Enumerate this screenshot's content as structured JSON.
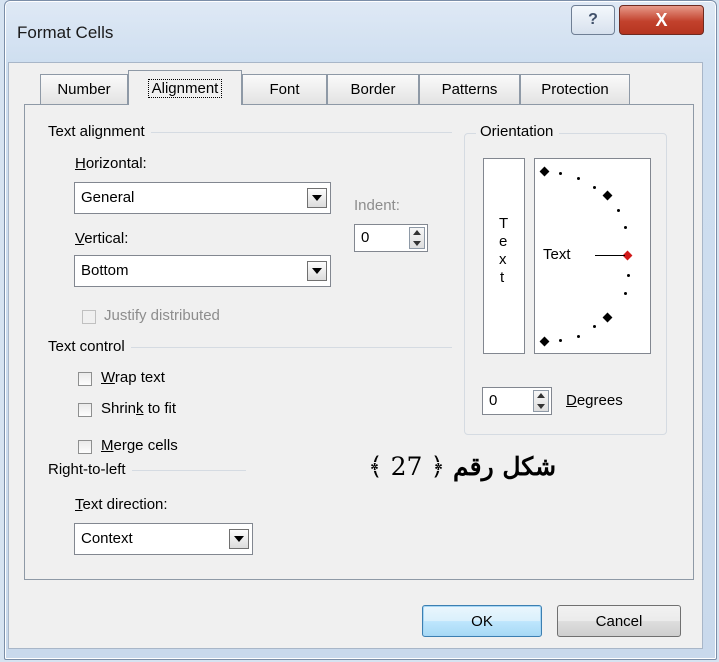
{
  "window": {
    "title": "Format Cells",
    "help_glyph": "?",
    "close_glyph": "X"
  },
  "tabs": [
    {
      "label": "Number"
    },
    {
      "label": "Alignment",
      "active": true
    },
    {
      "label": "Font"
    },
    {
      "label": "Border"
    },
    {
      "label": "Patterns"
    },
    {
      "label": "Protection"
    }
  ],
  "text_alignment": {
    "group_label": "Text alignment",
    "horizontal_label": "Horizontal:",
    "horizontal_value": "General",
    "vertical_label": "Vertical:",
    "vertical_value": "Bottom",
    "indent_label": "Indent:",
    "indent_value": "0",
    "justify_distributed_label": "Justify distributed"
  },
  "text_control": {
    "group_label": "Text control",
    "wrap_text_label": "Wrap text",
    "shrink_to_fit_label": "Shrink to fit",
    "merge_cells_label": "Merge cells"
  },
  "right_to_left": {
    "group_label": "Right-to-left",
    "text_direction_label": "Text direction:",
    "text_direction_value": "Context"
  },
  "orientation": {
    "group_label": "Orientation",
    "vertical_text": [
      "T",
      "e",
      "x",
      "t"
    ],
    "dial_text": "Text",
    "degrees_value": "0",
    "degrees_label": "Degrees"
  },
  "caption": {
    "text": "شكل رقم",
    "number": "27",
    "open_ornament": "﴿",
    "close_ornament": "﴾"
  },
  "buttons": {
    "ok": "OK",
    "cancel": "Cancel"
  },
  "colors": {
    "close_button": "#c2412c",
    "dial_marker_active": "#d11a1a",
    "window_frame": "#cfdff0"
  }
}
